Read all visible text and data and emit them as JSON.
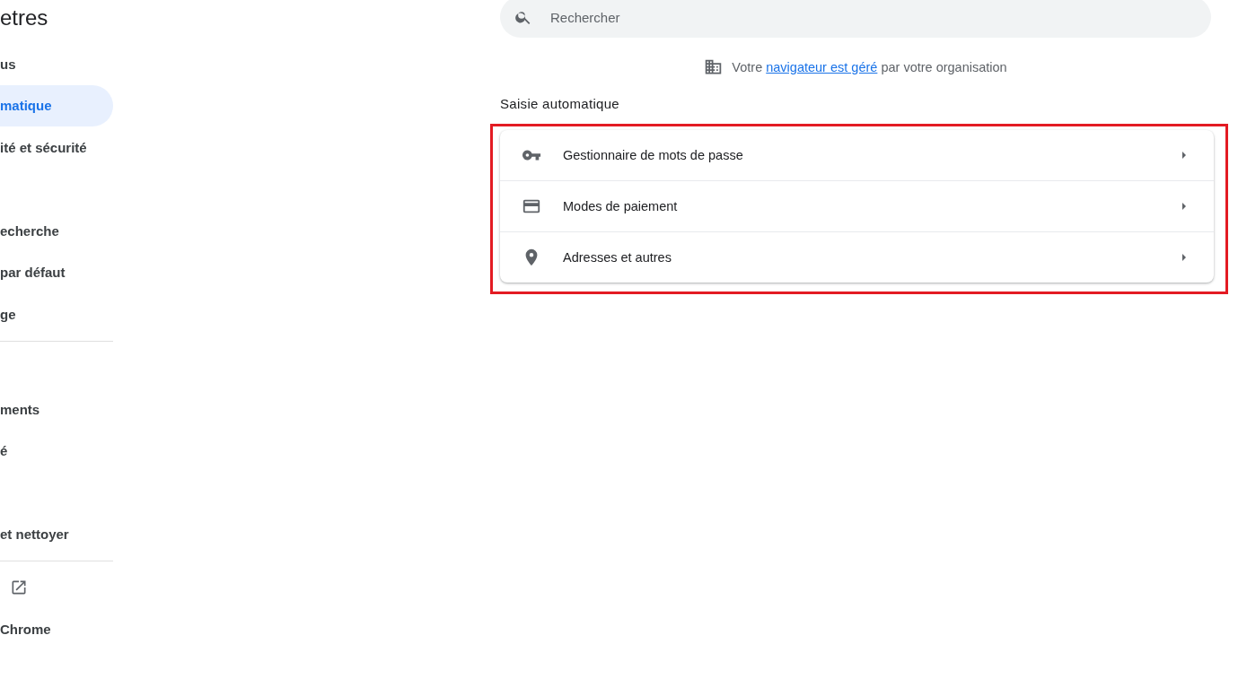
{
  "sidebar": {
    "title": "etres",
    "groups": [
      {
        "items": [
          {
            "kind": "label",
            "label": "us",
            "selected": false
          },
          {
            "kind": "label",
            "label": "matique",
            "selected": true
          },
          {
            "kind": "label",
            "label": "ité et sécurité",
            "selected": false
          },
          {
            "kind": "blank"
          },
          {
            "kind": "label",
            "label": "echerche",
            "selected": false
          },
          {
            "kind": "label",
            "label": "par défaut",
            "selected": false
          },
          {
            "kind": "label",
            "label": "ge",
            "selected": false
          }
        ]
      },
      {
        "items": [
          {
            "kind": "blank"
          },
          {
            "kind": "label",
            "label": "ments",
            "selected": false
          },
          {
            "kind": "label",
            "label": "é",
            "selected": false
          },
          {
            "kind": "blank"
          },
          {
            "kind": "label",
            "label": "et nettoyer",
            "selected": false
          }
        ]
      },
      {
        "items": [
          {
            "kind": "external"
          },
          {
            "kind": "label",
            "label": "Chrome",
            "selected": false
          }
        ]
      }
    ]
  },
  "search": {
    "placeholder": "Rechercher"
  },
  "managed_notice": {
    "before": "Votre",
    "link": "navigateur est géré",
    "after": "par votre organisation"
  },
  "section": {
    "title": "Saisie automatique",
    "highlighted": true,
    "rows": [
      {
        "kind": "key",
        "label": "Gestionnaire de mots de passe"
      },
      {
        "kind": "card",
        "label": "Modes de paiement"
      },
      {
        "kind": "pin",
        "label": "Adresses et autres"
      }
    ]
  }
}
